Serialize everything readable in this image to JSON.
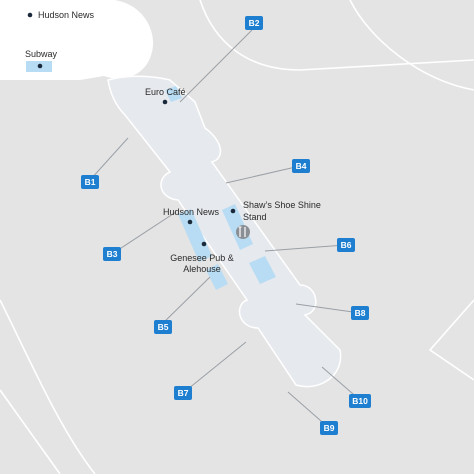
{
  "map": {
    "colors": {
      "background": "#e4e4e4",
      "building": "#ffffff",
      "concourse": "#e6e9ee",
      "shop_highlight": "#b8dcf3",
      "gate_badge": "#1e7fd0",
      "road_line": "#ffffff",
      "leader_line": "#9aa0a6"
    },
    "gates": [
      {
        "id": "B1",
        "label": "B1"
      },
      {
        "id": "B2",
        "label": "B2"
      },
      {
        "id": "B3",
        "label": "B3"
      },
      {
        "id": "B4",
        "label": "B4"
      },
      {
        "id": "B5",
        "label": "B5"
      },
      {
        "id": "B6",
        "label": "B6"
      },
      {
        "id": "B7",
        "label": "B7"
      },
      {
        "id": "B8",
        "label": "B8"
      },
      {
        "id": "B9",
        "label": "B9"
      },
      {
        "id": "B10",
        "label": "B10"
      }
    ],
    "places": {
      "hudson_news_top": "Hudson News",
      "subway": "Subway",
      "euro_cafe": "Euro Café",
      "hudson_news_concourse": "Hudson News",
      "shaws_line1": "Shaw’s Shoe Shine",
      "shaws_line2": "Stand",
      "genesee_line1": "Genesee Pub &",
      "genesee_line2": "Alehouse"
    },
    "icons": {
      "restaurant": "fork-knife-icon"
    }
  }
}
